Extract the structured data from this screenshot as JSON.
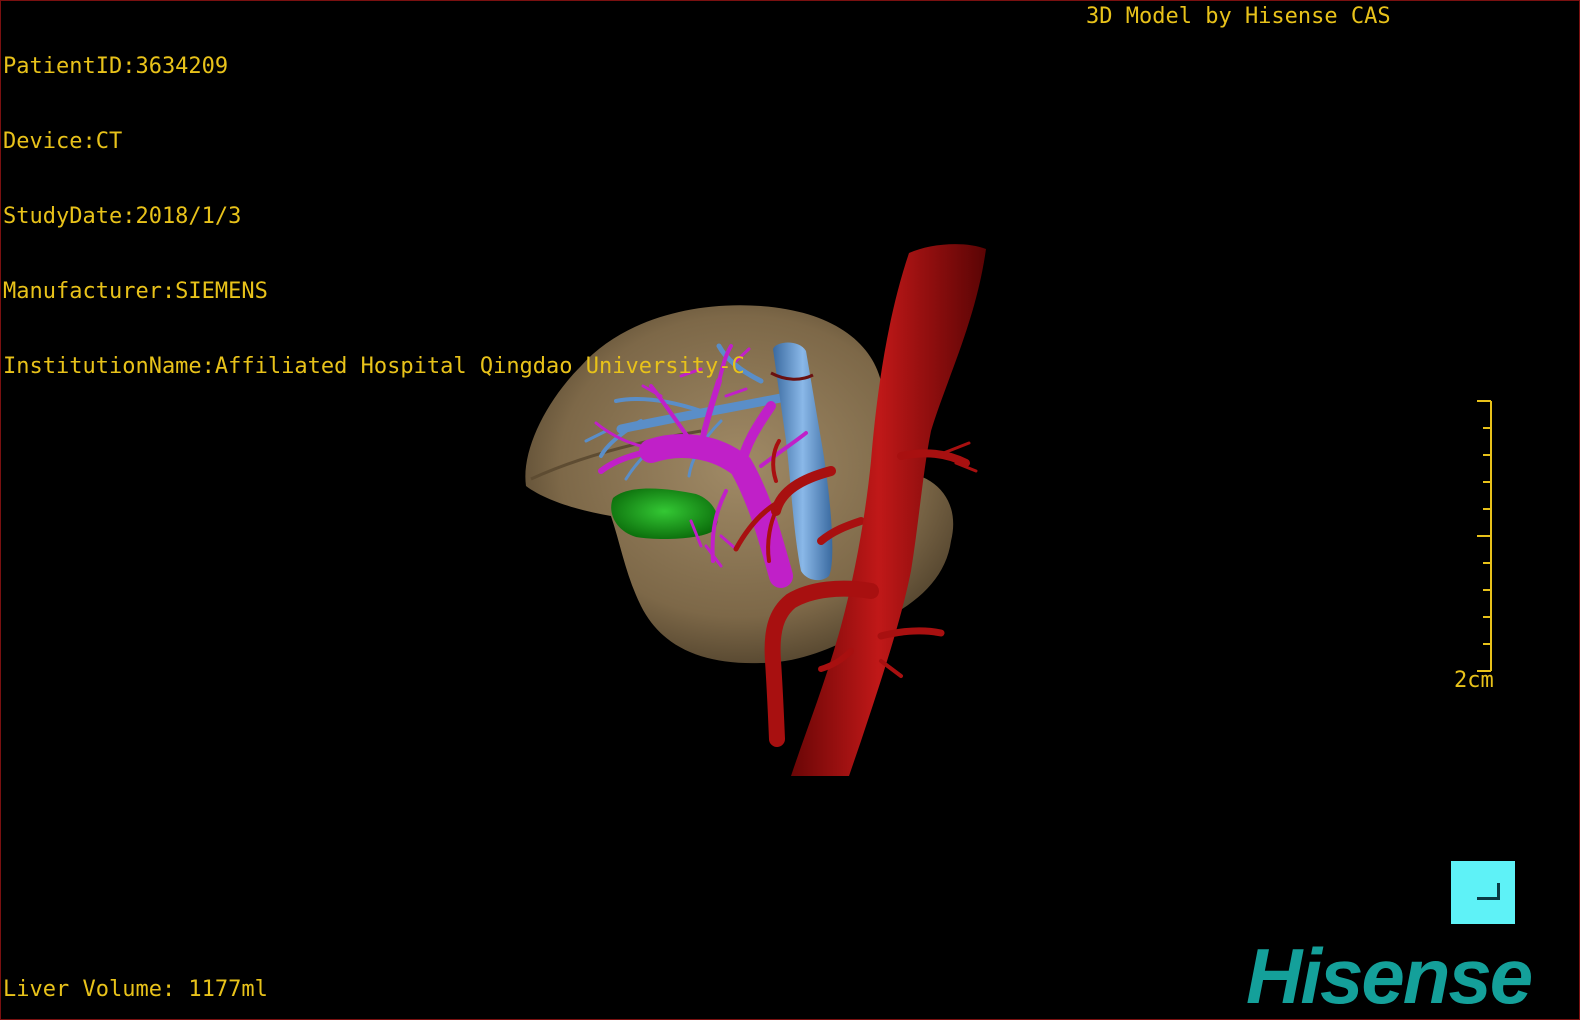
{
  "overlay": {
    "patient_id": "PatientID:3634209",
    "device": "Device:CT",
    "study_date": "StudyDate:2018/1/3",
    "manufacturer": "Manufacturer:SIEMENS",
    "institution": "InstitutionName:Affiliated Hospital Qingdao University-C",
    "credit": "3D Model by Hisense CAS",
    "liver_volume": "Liver Volume: 1177ml"
  },
  "scale_bar": {
    "label": "2cm"
  },
  "brand": {
    "logo_text": "Hisense"
  },
  "colors": {
    "overlay_text": "#e8c21a",
    "liver": "#8a7454",
    "aorta_artery": "#a81010",
    "portal_vein": "#c020c8",
    "hepatic_vein_ivc": "#5a8ec8",
    "tumor": "#1a9a1a",
    "corner_button": "#5ef2f7",
    "logo": "#14a09a"
  },
  "icons": {
    "corner_button": "corner-bracket-icon"
  }
}
